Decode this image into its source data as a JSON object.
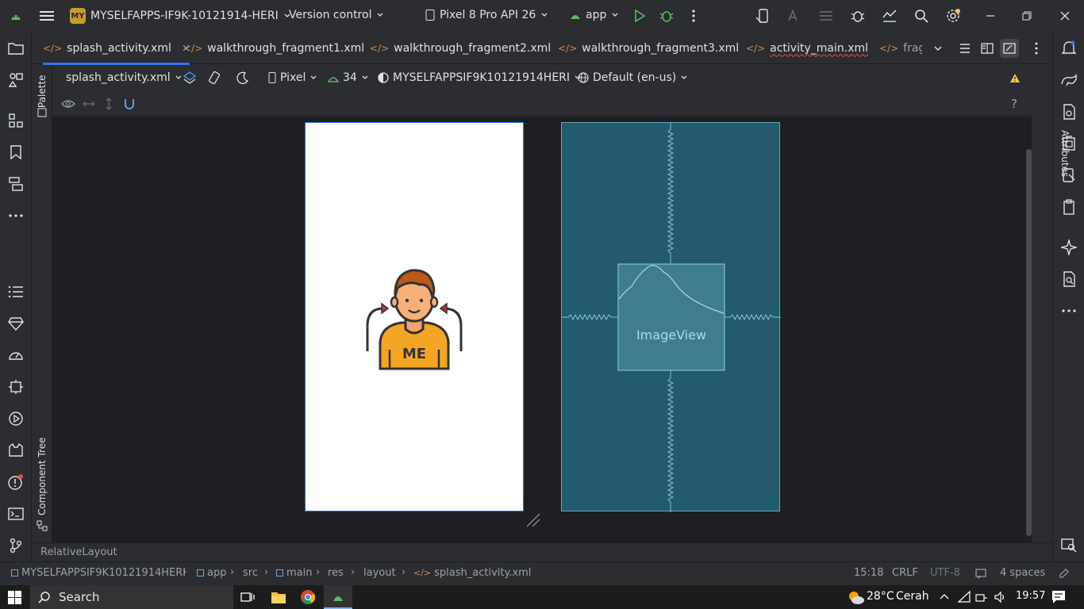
{
  "titlebar": {
    "project_badge": "MY",
    "project_name": "MYSELFAPPS-IF9K-10121914-HERI",
    "version_control": "Version control",
    "device": "Pixel 8 Pro API 26",
    "run_config": "app"
  },
  "tabs": [
    {
      "label": "splash_activity.xml",
      "active": true
    },
    {
      "label": "walkthrough_fragment1.xml"
    },
    {
      "label": "walkthrough_fragment2.xml"
    },
    {
      "label": "walkthrough_fragment3.xml"
    },
    {
      "label": "activity_main.xml",
      "error": true
    },
    {
      "label": "fragm"
    }
  ],
  "tab_icon_text": "</>",
  "design_toolbar": {
    "file": "splash_activity.xml",
    "device": "Pixel",
    "api": "34",
    "theme": "MYSELFAPPSIF9K10121914HERI",
    "locale": "Default (en-us)",
    "help": "?"
  },
  "side_panels": {
    "palette": "Palette",
    "component_tree": "Component Tree",
    "attributes": "Attributes"
  },
  "blueprint": {
    "label": "ImageView"
  },
  "illustration": {
    "shirt_text": "ME"
  },
  "status_line": "RelativeLayout",
  "breadcrumbs": [
    "MYSELFAPPSIF9K10121914HERI",
    "app",
    "src",
    "main",
    "res",
    "layout",
    "splash_activity.xml"
  ],
  "status_right": {
    "position": "15:18",
    "line_sep": "CRLF",
    "encoding": "UTF-8",
    "indent": "4 spaces"
  },
  "taskbar": {
    "search": "Search",
    "weather_temp": "28°C",
    "weather_text": "Cerah",
    "time": "19:57"
  },
  "colors": {
    "accent": "#3574f0",
    "blueprint_bg": "#235a6c",
    "run_green": "#5fb865",
    "warning": "#f2c55c"
  }
}
